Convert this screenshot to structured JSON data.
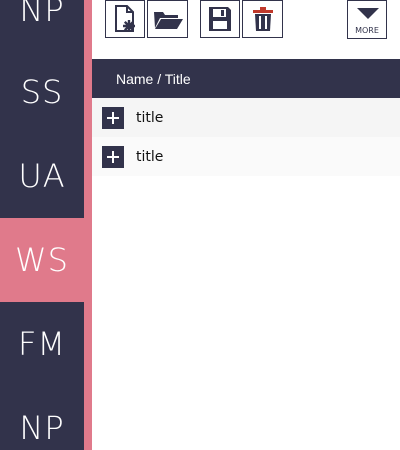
{
  "sidebar": {
    "items": [
      {
        "label": "NP"
      },
      {
        "label": "SS"
      },
      {
        "label": "UA"
      },
      {
        "label": "WS",
        "active": true
      },
      {
        "label": "FM"
      },
      {
        "label": "NP"
      }
    ]
  },
  "toolbar": {
    "buttons": [
      {
        "icon": "new-document-icon"
      },
      {
        "icon": "open-folder-icon"
      },
      {
        "icon": "save-icon"
      },
      {
        "icon": "trash-icon"
      }
    ],
    "more_label": "MORE"
  },
  "table": {
    "header": "Name / Title",
    "rows": [
      {
        "title": "title"
      },
      {
        "title": "title"
      }
    ]
  },
  "colors": {
    "navy": "#32334b",
    "accent": "#e07a8b",
    "trash_red": "#c0392b"
  }
}
